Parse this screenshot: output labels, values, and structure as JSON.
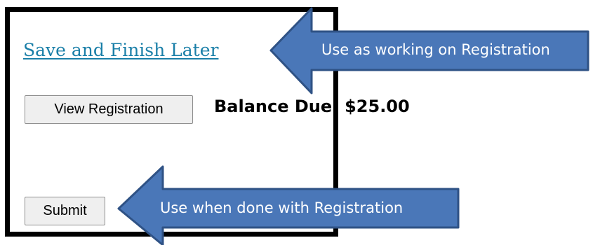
{
  "save_link": "Save and Finish Later",
  "view_button": "View Registration",
  "balance_due": "Balance Due: $25.00",
  "submit_button": "Submit",
  "callout_top": "Use as working on Registration",
  "callout_bottom": "Use when done with Registration",
  "colors": {
    "arrow_fill": "#4a77b8",
    "arrow_stroke": "#2f5285",
    "link": "#1a7fa8",
    "frame_border": "#000000"
  }
}
